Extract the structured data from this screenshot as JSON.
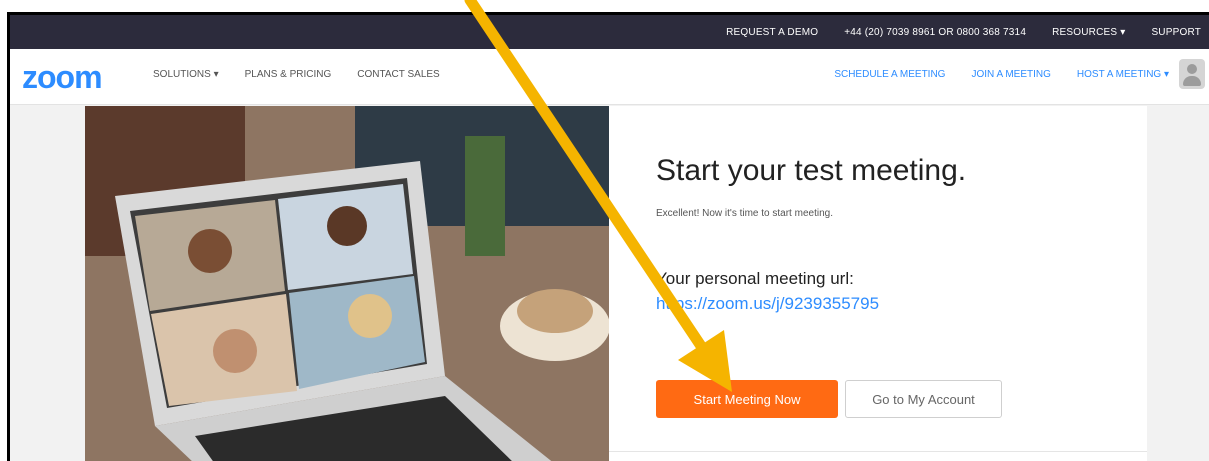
{
  "topbar": {
    "request_demo": "REQUEST A DEMO",
    "phone": "+44 (20) 7039 8961 OR 0800 368 7314",
    "resources": "RESOURCES ▾",
    "support": "SUPPORT"
  },
  "nav": {
    "logo": "zoom",
    "solutions": "SOLUTIONS ▾",
    "plans": "PLANS & PRICING",
    "contact": "CONTACT SALES",
    "schedule": "SCHEDULE A MEETING",
    "join": "JOIN A MEETING",
    "host": "HOST A MEETING ▾"
  },
  "main": {
    "heading": "Start your test meeting.",
    "subtitle": "Excellent! Now it's time to start meeting.",
    "url_label": "Your personal meeting url:",
    "url": "https://zoom.us/j/9239355795",
    "start_button": "Start Meeting Now",
    "account_button": "Go to My Account"
  },
  "colors": {
    "accent": "#2d8cff",
    "start_button": "#ff6a13",
    "annotation_arrow": "#f5b400"
  }
}
